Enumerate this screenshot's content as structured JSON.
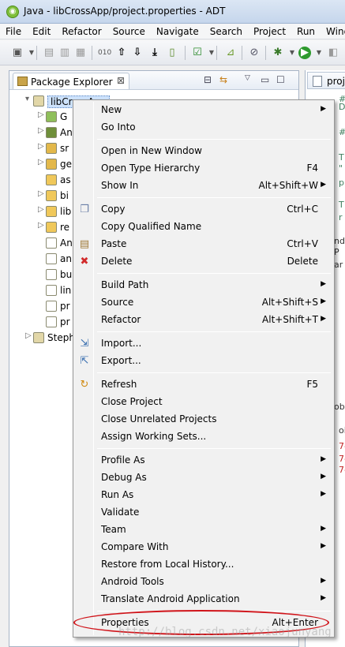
{
  "window": {
    "title": "Java - libCrossApp/project.properties - ADT"
  },
  "menubar": [
    "File",
    "Edit",
    "Refactor",
    "Source",
    "Navigate",
    "Search",
    "Project",
    "Run",
    "Windo"
  ],
  "panel": {
    "tab_label": "Package Explorer",
    "close_glyph": "⊠"
  },
  "editor": {
    "tab_label": "proje",
    "lines": [
      "#",
      "D",
      "#",
      "T",
      "\"",
      "p",
      "T",
      "r",
      "nd",
      "P",
      "ar",
      "obl",
      "oid",
      "7-",
      "7-",
      "7-"
    ]
  },
  "tree": [
    {
      "label": "libCrossApp",
      "icon": "project-icon",
      "arrow": "▾",
      "level": 0
    },
    {
      "label": "G",
      "icon": "gen-folder-icon",
      "arrow": "▷",
      "level": 1
    },
    {
      "label": "An",
      "icon": "android-lib-icon",
      "arrow": "▷",
      "level": 1
    },
    {
      "label": "sr",
      "icon": "src-folder-icon",
      "arrow": "▷",
      "level": 1
    },
    {
      "label": "ge",
      "icon": "src-folder-icon",
      "arrow": "▷",
      "level": 1
    },
    {
      "label": "as",
      "icon": "folder-icon",
      "arrow": "",
      "level": 1
    },
    {
      "label": "bi",
      "icon": "folder-icon",
      "arrow": "▷",
      "level": 1
    },
    {
      "label": "lib",
      "icon": "folder-icon",
      "arrow": "▷",
      "level": 1
    },
    {
      "label": "re",
      "icon": "folder-icon",
      "arrow": "▷",
      "level": 1
    },
    {
      "label": "An",
      "icon": "xml-file-icon",
      "arrow": "",
      "level": 1
    },
    {
      "label": "an",
      "icon": "file-icon",
      "arrow": "",
      "level": 1
    },
    {
      "label": "bu",
      "icon": "xml-file-icon",
      "arrow": "",
      "level": 1
    },
    {
      "label": "lin",
      "icon": "xml-file-icon",
      "arrow": "",
      "level": 1
    },
    {
      "label": "pr",
      "icon": "file-icon",
      "arrow": "",
      "level": 1
    },
    {
      "label": "pr",
      "icon": "file-icon",
      "arrow": "",
      "level": 1
    },
    {
      "label": "Steph",
      "icon": "project-icon",
      "arrow": "▷",
      "level": 0
    }
  ],
  "context_menu": {
    "groups": [
      [
        {
          "label": "New",
          "shortcut": "",
          "submenu": true,
          "icon": ""
        },
        {
          "label": "Go Into",
          "shortcut": "",
          "submenu": false,
          "icon": ""
        }
      ],
      [
        {
          "label": "Open in New Window",
          "shortcut": "",
          "submenu": false,
          "icon": ""
        },
        {
          "label": "Open Type Hierarchy",
          "shortcut": "F4",
          "submenu": false,
          "icon": ""
        },
        {
          "label": "Show In",
          "shortcut": "Alt+Shift+W",
          "submenu": true,
          "icon": ""
        }
      ],
      [
        {
          "label": "Copy",
          "shortcut": "Ctrl+C",
          "submenu": false,
          "icon": "copy-icon"
        },
        {
          "label": "Copy Qualified Name",
          "shortcut": "",
          "submenu": false,
          "icon": ""
        },
        {
          "label": "Paste",
          "shortcut": "Ctrl+V",
          "submenu": false,
          "icon": "paste-icon"
        },
        {
          "label": "Delete",
          "shortcut": "Delete",
          "submenu": false,
          "icon": "delete-icon"
        }
      ],
      [
        {
          "label": "Build Path",
          "shortcut": "",
          "submenu": true,
          "icon": ""
        },
        {
          "label": "Source",
          "shortcut": "Alt+Shift+S",
          "submenu": true,
          "icon": ""
        },
        {
          "label": "Refactor",
          "shortcut": "Alt+Shift+T",
          "submenu": true,
          "icon": ""
        }
      ],
      [
        {
          "label": "Import...",
          "shortcut": "",
          "submenu": false,
          "icon": "import-icon"
        },
        {
          "label": "Export...",
          "shortcut": "",
          "submenu": false,
          "icon": "export-icon"
        }
      ],
      [
        {
          "label": "Refresh",
          "shortcut": "F5",
          "submenu": false,
          "icon": "refresh-icon"
        },
        {
          "label": "Close Project",
          "shortcut": "",
          "submenu": false,
          "icon": ""
        },
        {
          "label": "Close Unrelated Projects",
          "shortcut": "",
          "submenu": false,
          "icon": ""
        },
        {
          "label": "Assign Working Sets...",
          "shortcut": "",
          "submenu": false,
          "icon": ""
        }
      ],
      [
        {
          "label": "Profile As",
          "shortcut": "",
          "submenu": true,
          "icon": ""
        },
        {
          "label": "Debug As",
          "shortcut": "",
          "submenu": true,
          "icon": ""
        },
        {
          "label": "Run As",
          "shortcut": "",
          "submenu": true,
          "icon": ""
        },
        {
          "label": "Validate",
          "shortcut": "",
          "submenu": false,
          "icon": ""
        },
        {
          "label": "Team",
          "shortcut": "",
          "submenu": true,
          "icon": ""
        },
        {
          "label": "Compare With",
          "shortcut": "",
          "submenu": true,
          "icon": ""
        },
        {
          "label": "Restore from Local History...",
          "shortcut": "",
          "submenu": false,
          "icon": ""
        },
        {
          "label": "Android Tools",
          "shortcut": "",
          "submenu": true,
          "icon": ""
        },
        {
          "label": "Translate Android Application",
          "shortcut": "",
          "submenu": true,
          "icon": ""
        }
      ],
      [
        {
          "label": "Properties",
          "shortcut": "Alt+Enter",
          "submenu": false,
          "icon": ""
        }
      ]
    ]
  },
  "watermark": "http://blog.csdn.net/xiaojunyang",
  "colors": {
    "highlight_ellipse": "#d0141a",
    "menu_bg": "#f1f1f1"
  }
}
